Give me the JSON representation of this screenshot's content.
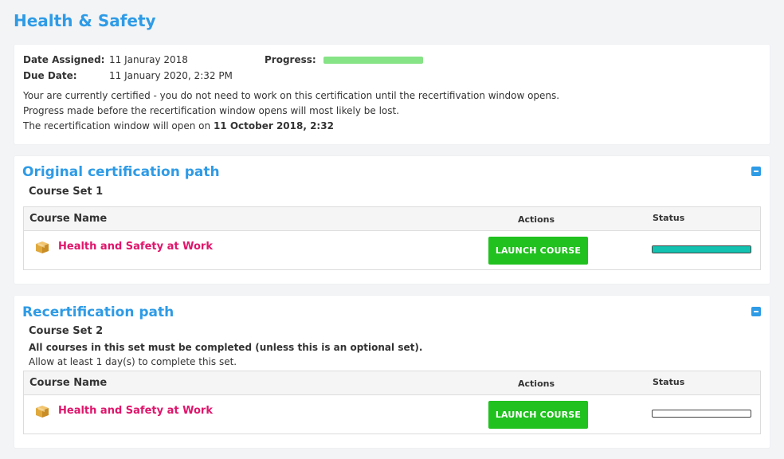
{
  "page": {
    "title": "Health & Safety"
  },
  "certification": {
    "date_assigned_label": "Date Assigned:",
    "date_assigned": "11 Januray 2018",
    "due_date_label": "Due Date:",
    "due_date": "11 January 2020, 2:32 PM",
    "progress_label": "Progress:",
    "progress_value": 1.0,
    "notice_line1": "Your are currently certified - you do not need to work on this certification until the recertifivation window opens.",
    "notice_line2": "Progress made before the recertification window opens will most likely be lost.",
    "notice_line3_prefix": "The recertification window will open on ",
    "notice_line3_date": "11 October 2018, 2:32"
  },
  "original_path": {
    "title": "Original certification path",
    "set_name": "Course Set 1",
    "columns": {
      "name": "Course Name",
      "actions": "Actions",
      "status": "Status"
    },
    "rows": [
      {
        "course": "Health and Safety at Work",
        "action_label": "LAUNCH COURSE",
        "status_value": 1.0
      }
    ]
  },
  "recert_path": {
    "title": "Recertification path",
    "set_name": "Course Set 2",
    "rule": "All courses in this set must be completed (unless this is an optional set).",
    "time_note": "Allow at least 1 day(s) to complete this set.",
    "columns": {
      "name": "Course Name",
      "actions": "Actions",
      "status": "Status"
    },
    "rows": [
      {
        "course": "Health and Safety at Work",
        "action_label": "LAUNCH COURSE",
        "status_value": 0.0
      }
    ]
  },
  "colors": {
    "accent": "#2e9be6",
    "link": "#e0156b",
    "button": "#21c11f",
    "progress": "#86e386",
    "status_complete": "#13c2b0"
  },
  "icons": {
    "course": "package-box-icon",
    "collapse": "minus-square-icon"
  }
}
